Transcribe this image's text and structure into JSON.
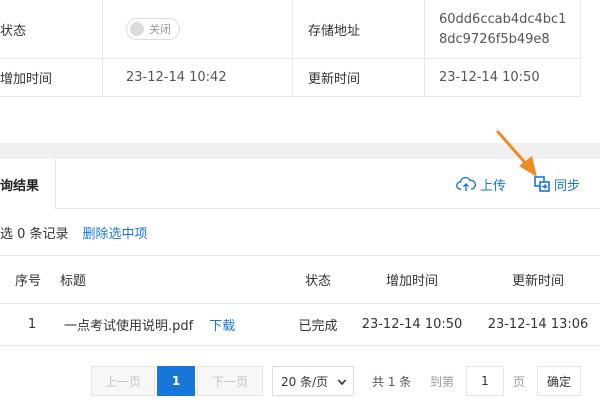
{
  "detail": {
    "status_label": "状态",
    "status_toggle": "关闭",
    "storage_label": "存储地址",
    "storage_value_line1": "60dd6ccab4dc4bc1",
    "storage_value_line2": "8dc9726f5b49e8",
    "added_label": "增加时间",
    "added_value": "23-12-14 10:42",
    "updated_label": "更新时间",
    "updated_value": "23-12-14 10:50"
  },
  "tabs": {
    "active_label": "询结果",
    "upload_label": "上传",
    "sync_label": "同步"
  },
  "toolbar": {
    "selection_text": "选 0 条记录",
    "delete_selected_label": "删除选中项"
  },
  "table": {
    "headers": [
      "序号",
      "标题",
      "状态",
      "增加时间",
      "更新时间"
    ],
    "rows": [
      {
        "index": "1",
        "title": "一点考试使用说明.pdf",
        "download_label": "下载",
        "status": "已完成",
        "added": "23-12-14 10:50",
        "updated": "23-12-14 13:06"
      }
    ]
  },
  "pagination": {
    "prev_label": "上一页",
    "current_page": "1",
    "next_label": "下一页",
    "page_size": "20 条/页",
    "total_text": "共 1 条",
    "goto_label": "到第",
    "goto_value": "1",
    "page_suffix": "页",
    "confirm_label": "确定"
  },
  "colors": {
    "link": "#1677d8",
    "arrow": "#f08a24",
    "border": "#e8e8e8",
    "section_gap": "#f0f0f0"
  }
}
